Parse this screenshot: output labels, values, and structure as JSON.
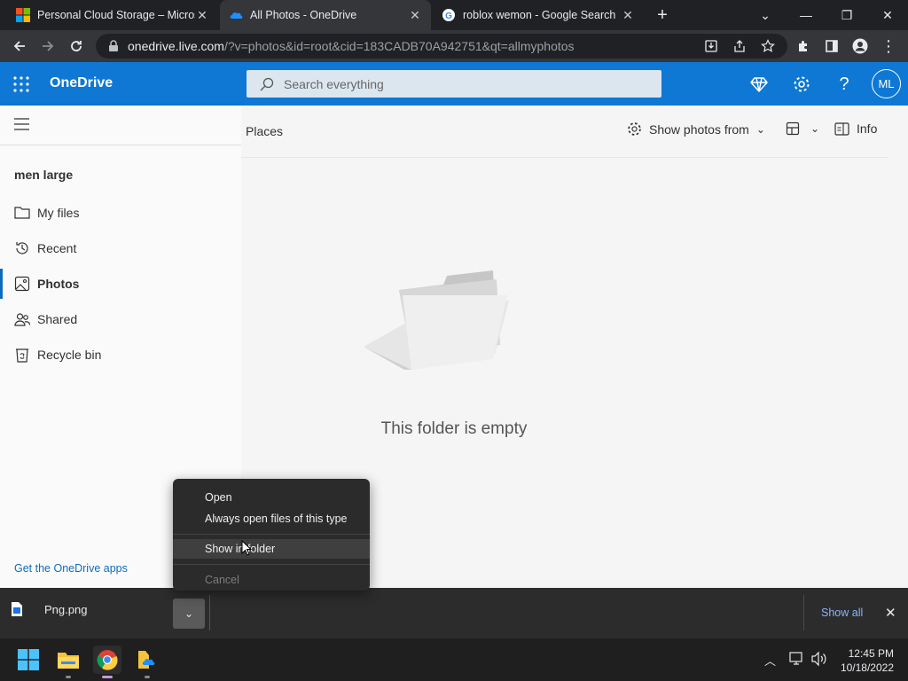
{
  "browser": {
    "tabs": [
      {
        "title": "Personal Cloud Storage – Microsoft",
        "icon": "microsoft-logo-icon",
        "active": false
      },
      {
        "title": "All Photos - OneDrive",
        "icon": "onedrive-cloud-icon",
        "active": true
      },
      {
        "title": "roblox wemon - Google Search",
        "icon": "google-logo-icon",
        "active": false
      }
    ],
    "url_host": "onedrive.live.com",
    "url_path": "/?v=photos&id=root&cid=183CADB70A942751&qt=allmyphotos"
  },
  "header": {
    "app_name": "OneDrive",
    "search_placeholder": "Search everything",
    "avatar_initials": "ML"
  },
  "sidebar": {
    "user_name": "men large",
    "items": [
      {
        "label": "My files",
        "icon": "folder-icon"
      },
      {
        "label": "Recent",
        "icon": "history-icon"
      },
      {
        "label": "Photos",
        "icon": "photo-icon"
      },
      {
        "label": "Shared",
        "icon": "people-icon"
      },
      {
        "label": "Recycle bin",
        "icon": "recycle-bin-icon"
      }
    ],
    "get_apps_link": "Get the OneDrive apps"
  },
  "main": {
    "breadcrumb": "Places",
    "commands": {
      "show_photos_from": "Show photos from",
      "info": "Info"
    },
    "empty_message": "This folder is empty"
  },
  "context_menu": {
    "items": [
      {
        "label": "Open",
        "disabled": false,
        "highlighted": false
      },
      {
        "label": "Always open files of this type",
        "disabled": false,
        "highlighted": false
      },
      {
        "label": "Show in folder",
        "disabled": false,
        "highlighted": true
      },
      {
        "label": "Cancel",
        "disabled": true,
        "highlighted": false
      }
    ]
  },
  "download_shelf": {
    "file_name": "Png.png",
    "show_all": "Show all"
  },
  "taskbar": {
    "time": "12:45 PM",
    "date": "10/18/2022"
  },
  "colors": {
    "onedrive_blue": "#0f78d4",
    "accent": "#0f6cbd",
    "chrome_dark": "#202124"
  }
}
